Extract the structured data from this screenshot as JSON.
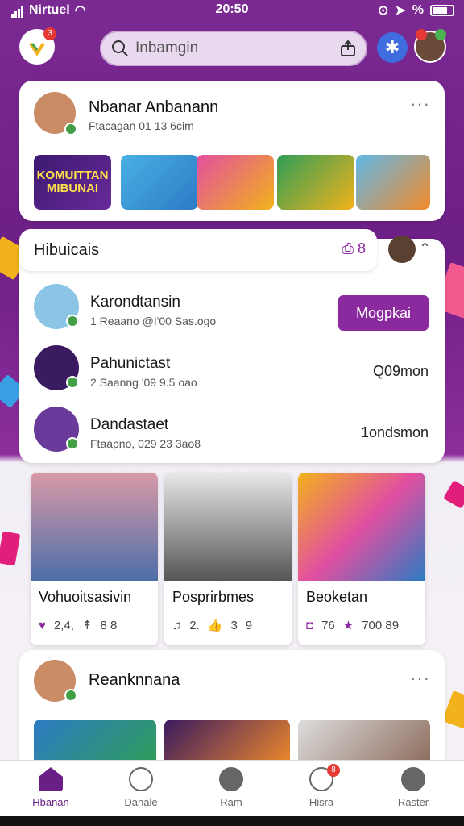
{
  "status": {
    "carrier": "Nirtuel",
    "time": "20:50",
    "percent": "%"
  },
  "top": {
    "search_placeholder": "Inbamgin",
    "badge_count": "3"
  },
  "profile_card": {
    "name": "Nbanar Anbanann",
    "subtitle": "Ftacagan 01 13 6cim",
    "thumbs": [
      "KOMUITTAN MIBUNAI",
      "",
      "",
      "",
      ""
    ]
  },
  "follow_section": {
    "title": "Hibuicais",
    "count": "8",
    "rows": [
      {
        "name": "Karondtansin",
        "meta": "1 Reaano @I'00 Sas.ogo",
        "action": "Mogpkai"
      },
      {
        "name": "Pahunictast",
        "meta": "2 Saanng '09 9.5 oao",
        "right": "Q09mon"
      },
      {
        "name": "Dandastaet",
        "meta": "Ftaapno, 029 23 3ao8",
        "right": "1ondsmon"
      }
    ]
  },
  "posts": [
    {
      "title": "Vohuoitsasivin",
      "s1": "2,4,",
      "s2": "8 8"
    },
    {
      "title": "Posprirbmes",
      "s1": "2.",
      "s2": "3",
      "s3": "9"
    },
    {
      "title": "Beoketan",
      "s1": "76",
      "s2": "700 89"
    }
  ],
  "last_card": {
    "name": "Reanknnana"
  },
  "nav": {
    "items": [
      {
        "label": "Hbanan"
      },
      {
        "label": "Danale"
      },
      {
        "label": "Ram"
      },
      {
        "label": "Hisra"
      },
      {
        "label": "Raster"
      }
    ],
    "badge": "8"
  },
  "colors": {
    "accent": "#8b2a9e",
    "bg_purple": "#7a2490",
    "verified": "#43a047"
  }
}
